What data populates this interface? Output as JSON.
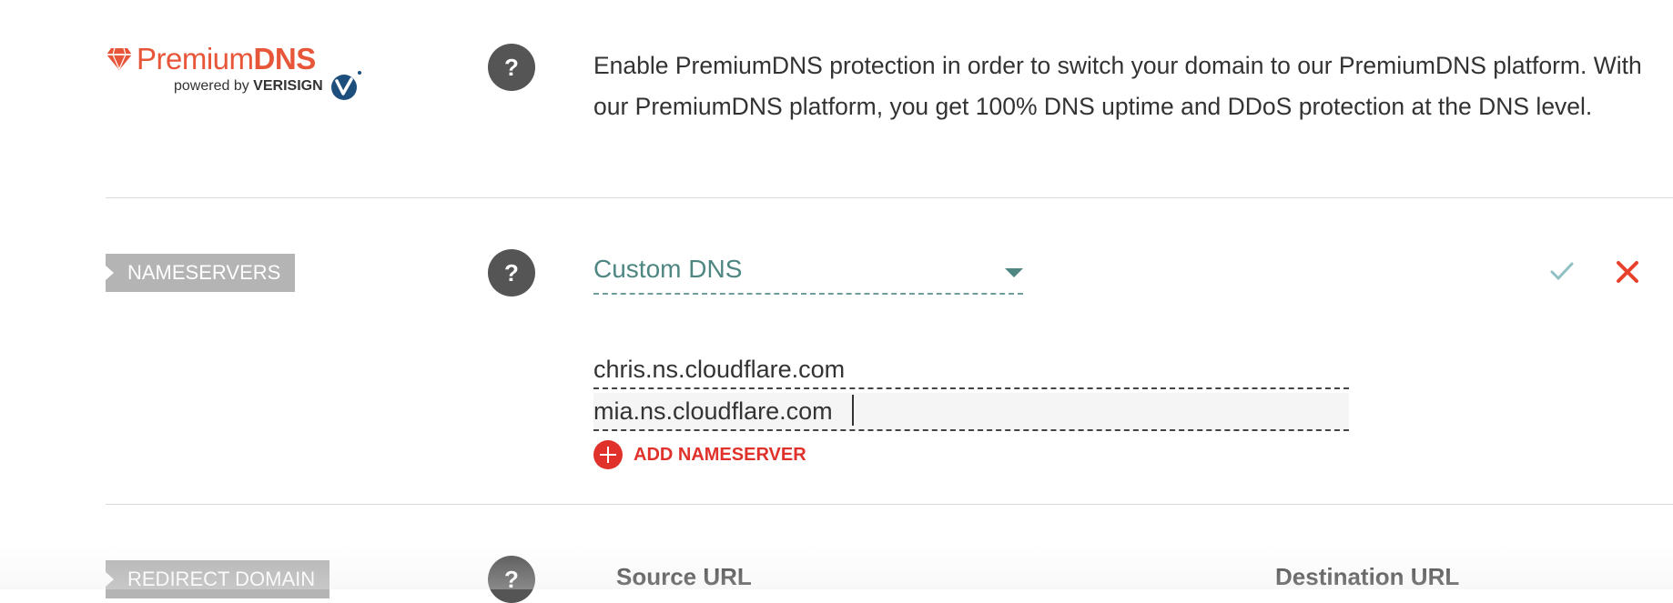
{
  "premium_dns": {
    "logo_title_regular": "Premium",
    "logo_title_bold": "DNS",
    "logo_sub_regular": "powered by ",
    "logo_sub_bold": "VERISIGN",
    "help_label": "?",
    "description": "Enable PremiumDNS protection in order to switch your domain to our PremiumDNS platform. With our PremiumDNS platform, you get 100% DNS uptime and DDoS protection at the DNS level."
  },
  "nameservers": {
    "section_label": "NAMESERVERS",
    "help_label": "?",
    "dns_type_selected": "Custom DNS",
    "entries": [
      "chris.ns.cloudflare.com",
      "mia.ns.cloudflare.com"
    ],
    "add_label": "ADD NAMESERVER"
  },
  "redirect_domain": {
    "section_label": "REDIRECT DOMAIN",
    "help_label": "?",
    "source_header": "Source URL",
    "destination_header": "Destination URL"
  },
  "colors": {
    "brand_orange": "#e8563a",
    "teal": "#4e8682",
    "danger_red": "#e0312b",
    "tag_gray": "#b4b4b4"
  },
  "icons": [
    "gem-icon",
    "verisign-check-icon",
    "help-icon",
    "chevron-down-icon",
    "checkmark-icon",
    "close-icon",
    "plus-circle-icon"
  ]
}
